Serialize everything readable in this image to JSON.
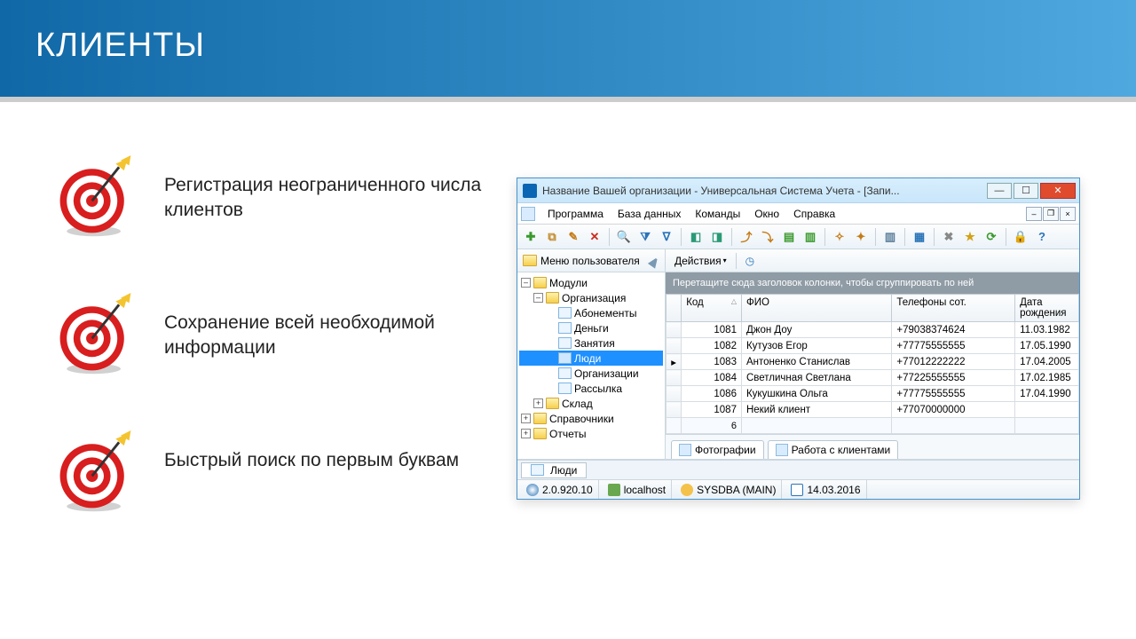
{
  "hero_title": "КЛИЕНТЫ",
  "bullets": [
    "Регистрация неограниченного числа клиентов",
    "Сохранение всей необходимой информации",
    "Быстрый поиск по первым буквам"
  ],
  "window": {
    "title": "Название Вашей организации - Универсальная Система Учета - [Запи...",
    "menu": [
      "Программа",
      "База данных",
      "Команды",
      "Окно",
      "Справка"
    ],
    "tree_header": "Меню пользователя",
    "tree": {
      "root": "Модули",
      "org": "Организация",
      "org_children": [
        "Абонементы",
        "Деньги",
        "Занятия",
        "Люди",
        "Организации",
        "Рассылка"
      ],
      "selected": "Люди",
      "other": [
        "Склад",
        "Справочники",
        "Отчеты"
      ]
    },
    "actions_label": "Действия",
    "group_hint": "Перетащите сюда заголовок колонки, чтобы сгруппировать по ней",
    "columns": [
      "Код",
      "ФИО",
      "Телефоны сот.",
      "Дата рождения"
    ],
    "rows": [
      {
        "id": 1081,
        "name": "Джон Доу",
        "phone": "+79038374624",
        "dob": "11.03.1982",
        "mark": ""
      },
      {
        "id": 1082,
        "name": "Кутузов Егор",
        "phone": "+77775555555",
        "dob": "17.05.1990",
        "mark": ""
      },
      {
        "id": 1083,
        "name": "Антоненко Станислав",
        "phone": "+77012222222",
        "dob": "17.04.2005",
        "mark": "▸"
      },
      {
        "id": 1084,
        "name": "Светличная Светлана",
        "phone": "+77225555555",
        "dob": "17.02.1985",
        "mark": ""
      },
      {
        "id": 1086,
        "name": "Кукушкина Ольга",
        "phone": "+77775555555",
        "dob": "17.04.1990",
        "mark": ""
      },
      {
        "id": 1087,
        "name": "Некий клиент",
        "phone": "+77070000000",
        "dob": "",
        "mark": ""
      }
    ],
    "row_count": "6",
    "tabs": [
      "Фотографии",
      "Работа с клиентами"
    ],
    "doc_tab": "Люди",
    "status": {
      "version": "2.0.920.10",
      "host": "localhost",
      "user": "SYSDBA (MAIN)",
      "date": "14.03.2016"
    }
  },
  "toolbar_icons": [
    {
      "n": "add-icon",
      "g": "✚",
      "c": "#3a9a2d"
    },
    {
      "n": "copy-icon",
      "g": "⧉",
      "c": "#c28a2a"
    },
    {
      "n": "edit-icon",
      "g": "✎",
      "c": "#c67b18"
    },
    {
      "n": "delete-icon",
      "g": "✕",
      "c": "#cc2a1e"
    },
    {
      "sep": true
    },
    {
      "n": "search-icon",
      "g": "🔍",
      "c": "#2a74b8"
    },
    {
      "n": "filter-icon",
      "g": "⧩",
      "c": "#2a74b8"
    },
    {
      "n": "funnel-icon",
      "g": "∇",
      "c": "#2a74b8"
    },
    {
      "sep": true
    },
    {
      "n": "link-child-icon",
      "g": "◧",
      "c": "#2a9a75"
    },
    {
      "n": "link-parent-icon",
      "g": "◨",
      "c": "#2a9a75"
    },
    {
      "sep": true
    },
    {
      "n": "export-icon",
      "g": "⤴",
      "c": "#c67b18"
    },
    {
      "n": "import-icon",
      "g": "⤵",
      "c": "#c67b18"
    },
    {
      "n": "report-green-icon",
      "g": "▤",
      "c": "#3a9a2d"
    },
    {
      "n": "report-export-icon",
      "g": "▥",
      "c": "#3a9a2d"
    },
    {
      "sep": true
    },
    {
      "n": "new-doc-icon",
      "g": "✧",
      "c": "#c67b18"
    },
    {
      "n": "bookmark-icon",
      "g": "✦",
      "c": "#c67b18"
    },
    {
      "sep": true
    },
    {
      "n": "columns-icon",
      "g": "▥",
      "c": "#5a7d98"
    },
    {
      "sep": true
    },
    {
      "n": "calendar-icon",
      "g": "▦",
      "c": "#2a74b8"
    },
    {
      "sep": true
    },
    {
      "n": "tools-icon",
      "g": "✖",
      "c": "#888"
    },
    {
      "n": "favorite-icon",
      "g": "★",
      "c": "#d4a017"
    },
    {
      "n": "refresh-icon",
      "g": "⟳",
      "c": "#3a9a2d"
    },
    {
      "sep": true
    },
    {
      "n": "lock-icon",
      "g": "🔒",
      "c": "#c78a2d"
    },
    {
      "n": "help-icon",
      "g": "?",
      "c": "#2a74b8"
    }
  ]
}
